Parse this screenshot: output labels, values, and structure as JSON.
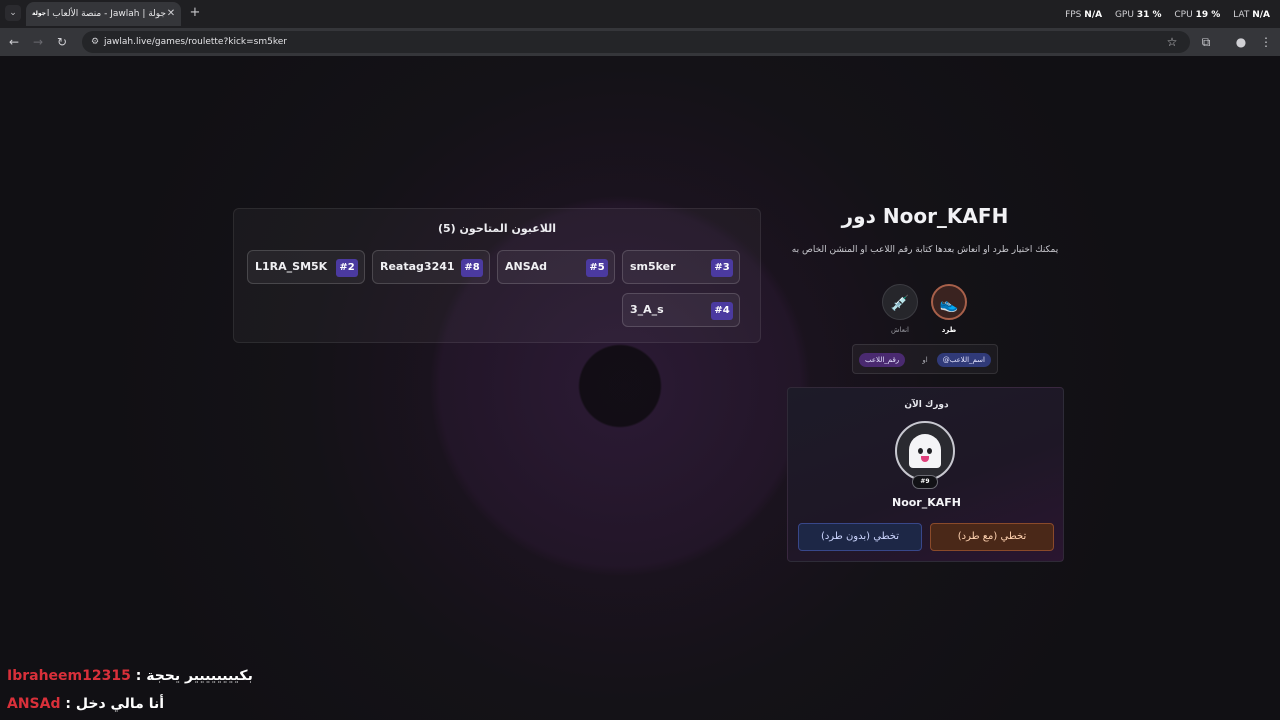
{
  "browser": {
    "tab_title": "جولة | Jawlah - منصة الألعاب الـ",
    "tab_favicon": "جولة",
    "url": "jawlah.live/games/roulette?kick=sm5ker",
    "perf": [
      {
        "label": "FPS",
        "value": "N/A"
      },
      {
        "label": "GPU",
        "value": "31 %"
      },
      {
        "label": "CPU",
        "value": "19 %"
      },
      {
        "label": "LAT",
        "value": "N/A"
      }
    ]
  },
  "players_panel": {
    "title": "اللاعبون المتاحون (5)",
    "players": [
      {
        "name": "sm5ker",
        "number": "#3"
      },
      {
        "name": "ANSAd",
        "number": "#5"
      },
      {
        "name": "Reatag3241",
        "number": "#8"
      },
      {
        "name": "L1RA_SM5K",
        "number": "#2"
      },
      {
        "name": "3_A_s",
        "number": "#4"
      }
    ]
  },
  "turn": {
    "title": "دور Noor_KAFH",
    "description": "يمكنك اختيار طرد او انعاش بعدها كتابة رقم اللاعب او المنشن الخاص به",
    "actions": [
      {
        "label": "طرد",
        "icon": "kick-shoe-icon"
      },
      {
        "label": "انعاش",
        "icon": "syringe-icon"
      }
    ],
    "hint": {
      "name_chip": "@اسم_اللاعب",
      "or": "او",
      "number_chip": "رقم_اللاعب"
    },
    "current": {
      "label": "دورك الآن",
      "badge": "#9",
      "name": "Noor_KAFH",
      "skip_with_kick": "تخطي (مع طرد)",
      "skip_without_kick": "تخطي (بدون طرد)"
    }
  },
  "chat": [
    {
      "user": "Ibraheem12315",
      "separator": " : ",
      "message": "بكيييييييير يحجة"
    },
    {
      "user": "ANSAd",
      "separator": " : ",
      "message": "أنا مالي دخل"
    }
  ],
  "colors": {
    "accent_purple": "#4b3aa0",
    "chat_user": "#d9303a",
    "kick_orange": "#a8604a"
  }
}
